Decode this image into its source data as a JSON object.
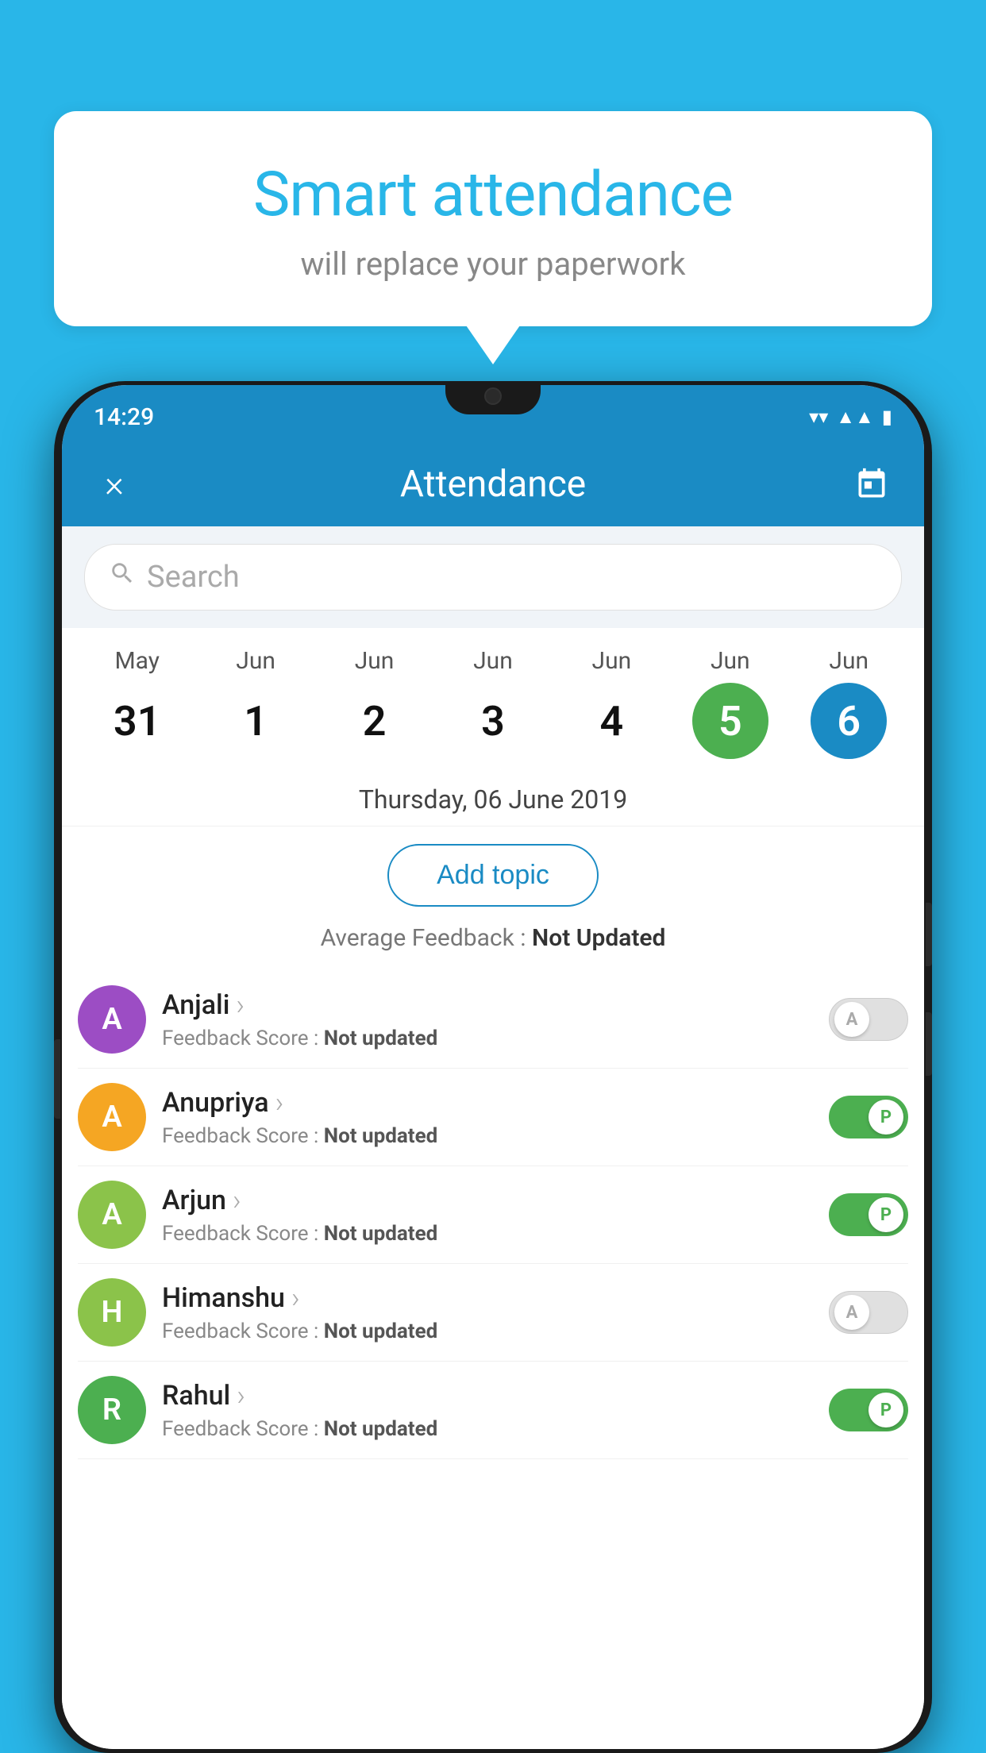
{
  "background_color": "#29b6e8",
  "bubble": {
    "title": "Smart attendance",
    "subtitle": "will replace your paperwork"
  },
  "status_bar": {
    "time": "14:29",
    "icons": [
      "wifi",
      "signal",
      "battery"
    ]
  },
  "header": {
    "title": "Attendance",
    "close_label": "×",
    "calendar_icon": "📅"
  },
  "search": {
    "placeholder": "Search"
  },
  "calendar": {
    "dates": [
      {
        "month": "May",
        "day": "31",
        "type": "normal"
      },
      {
        "month": "Jun",
        "day": "1",
        "type": "normal"
      },
      {
        "month": "Jun",
        "day": "2",
        "type": "normal"
      },
      {
        "month": "Jun",
        "day": "3",
        "type": "normal"
      },
      {
        "month": "Jun",
        "day": "4",
        "type": "normal"
      },
      {
        "month": "Jun",
        "day": "5",
        "type": "today"
      },
      {
        "month": "Jun",
        "day": "6",
        "type": "selected"
      }
    ]
  },
  "selected_date": "Thursday, 06 June 2019",
  "add_topic_label": "Add topic",
  "avg_feedback_label": "Average Feedback :",
  "avg_feedback_value": "Not Updated",
  "students": [
    {
      "name": "Anjali",
      "initial": "A",
      "avatar_color": "#9c4dc4",
      "feedback_label": "Feedback Score :",
      "feedback_value": "Not updated",
      "toggle": "off",
      "toggle_letter": "A"
    },
    {
      "name": "Anupriya",
      "initial": "A",
      "avatar_color": "#f5a623",
      "feedback_label": "Feedback Score :",
      "feedback_value": "Not updated",
      "toggle": "on",
      "toggle_letter": "P"
    },
    {
      "name": "Arjun",
      "initial": "A",
      "avatar_color": "#8bc34a",
      "feedback_label": "Feedback Score :",
      "feedback_value": "Not updated",
      "toggle": "on",
      "toggle_letter": "P"
    },
    {
      "name": "Himanshu",
      "initial": "H",
      "avatar_color": "#8bc34a",
      "feedback_label": "Feedback Score :",
      "feedback_value": "Not updated",
      "toggle": "off",
      "toggle_letter": "A"
    },
    {
      "name": "Rahul",
      "initial": "R",
      "avatar_color": "#4caf50",
      "feedback_label": "Feedback Score :",
      "feedback_value": "Not updated",
      "toggle": "on",
      "toggle_letter": "P"
    }
  ]
}
